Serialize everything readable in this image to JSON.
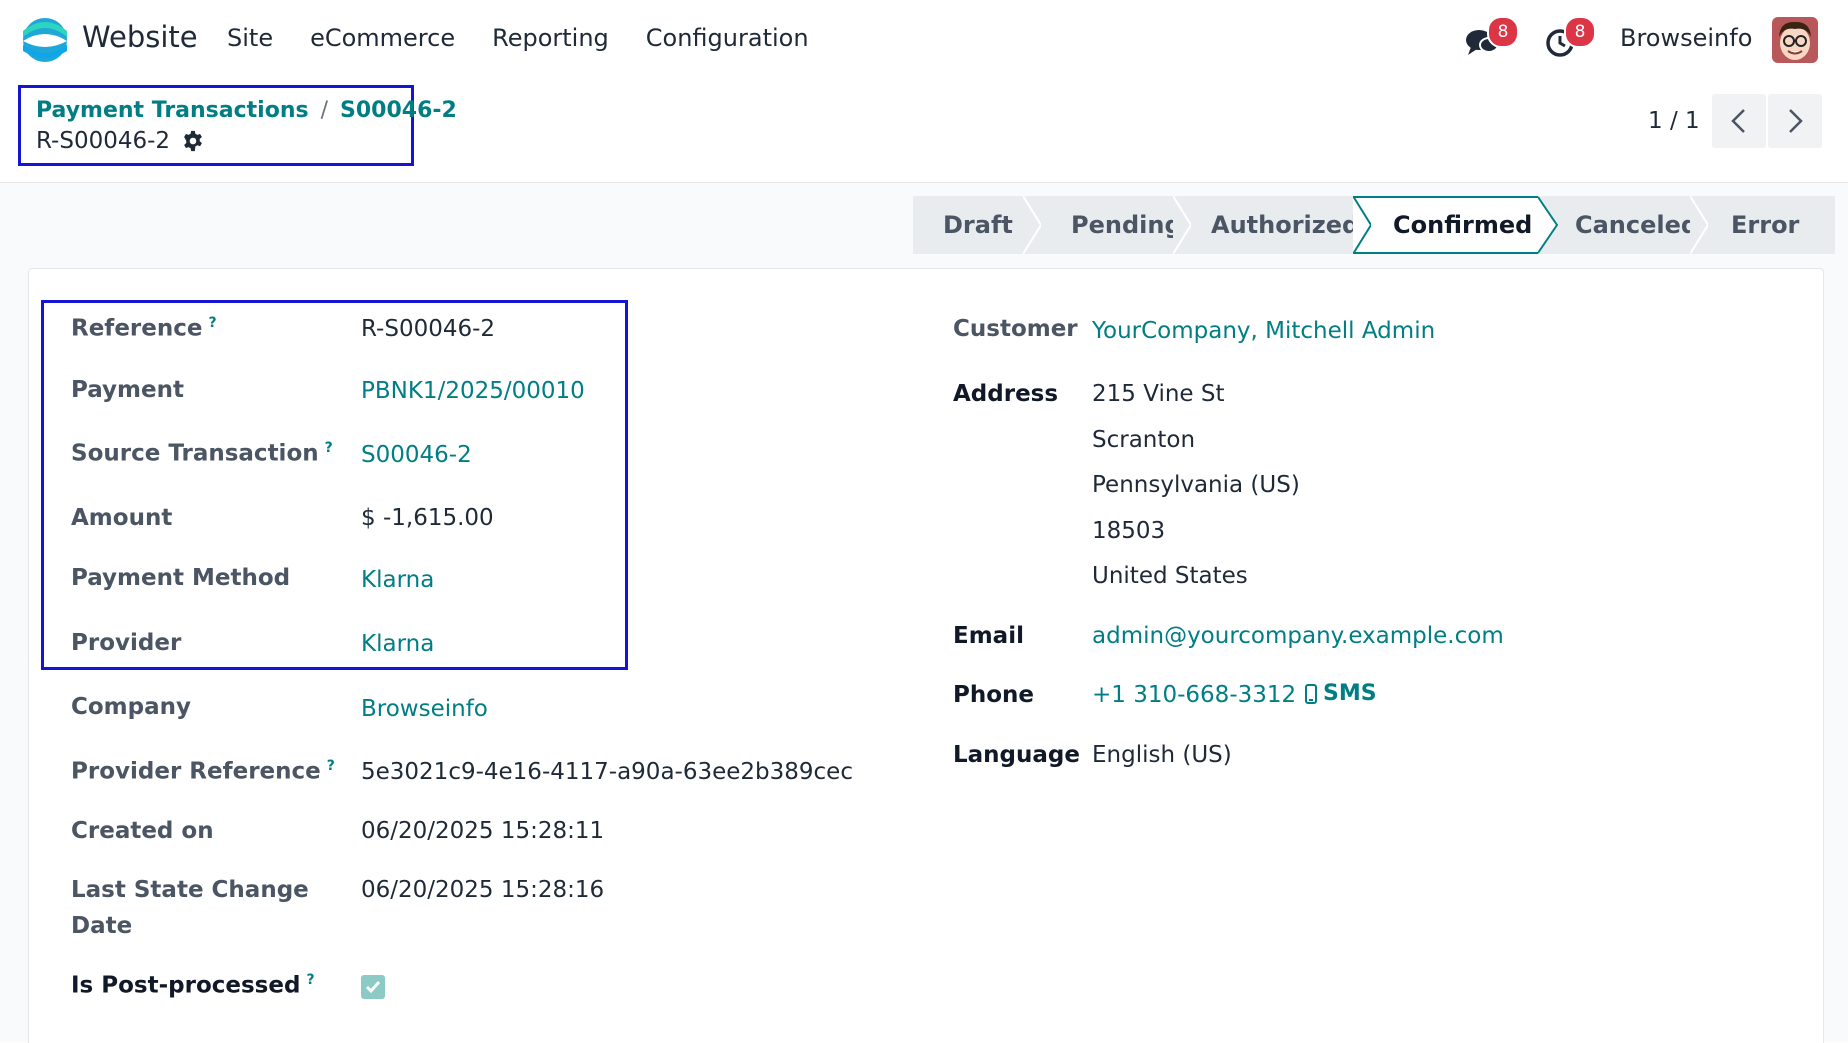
{
  "navbar": {
    "app_name": "Website",
    "menu": [
      "Site",
      "eCommerce",
      "Reporting",
      "Configuration"
    ],
    "chat_badge": "8",
    "activity_badge": "8",
    "user_name": "Browseinfo"
  },
  "breadcrumb": {
    "parent": "Payment Transactions",
    "separator": "/",
    "current": "S00046-2",
    "record_name": "R-S00046-2"
  },
  "pager": {
    "value": "1 / 1"
  },
  "status_stages": [
    "Draft",
    "Pending",
    "Authorized",
    "Confirmed",
    "Canceled",
    "Error"
  ],
  "active_stage": "Confirmed",
  "left_fields": {
    "reference": {
      "label": "Reference",
      "help": "?",
      "value": "R-S00046-2"
    },
    "payment": {
      "label": "Payment",
      "value": "PBNK1/2025/00010"
    },
    "source_transaction": {
      "label": "Source Transaction",
      "help": "?",
      "value": "S00046-2"
    },
    "amount": {
      "label": "Amount",
      "value": "$ -1,615.00"
    },
    "payment_method": {
      "label": "Payment Method",
      "value": "Klarna"
    },
    "provider": {
      "label": "Provider",
      "value": "Klarna"
    },
    "company": {
      "label": "Company",
      "value": "Browseinfo"
    },
    "provider_reference": {
      "label": "Provider Reference",
      "help": "?",
      "value": "5e3021c9-4e16-4117-a90a-63ee2b389cec"
    },
    "created_on": {
      "label": "Created on",
      "value": "06/20/2025 15:28:11"
    },
    "last_state_change": {
      "label_line1": "Last State Change",
      "label_line2": "Date",
      "value": "06/20/2025 15:28:16"
    },
    "post_processed": {
      "label": "Is Post-processed",
      "help": "?",
      "checked": true
    }
  },
  "right_fields": {
    "customer": {
      "label": "Customer",
      "value": "YourCompany, Mitchell Admin"
    },
    "address": {
      "label": "Address",
      "lines": [
        "215 Vine St",
        "Scranton",
        "Pennsylvania (US)",
        "18503",
        "United States"
      ]
    },
    "email": {
      "label": "Email",
      "value": "admin@yourcompany.example.com"
    },
    "phone": {
      "label": "Phone",
      "value": "+1 310-668-3312",
      "sms_label": "SMS"
    },
    "language": {
      "label": "Language",
      "value": "English (US)"
    }
  },
  "colors": {
    "link": "#017e84",
    "highlight_box": "#1414d4",
    "badge": "#dc3545"
  }
}
